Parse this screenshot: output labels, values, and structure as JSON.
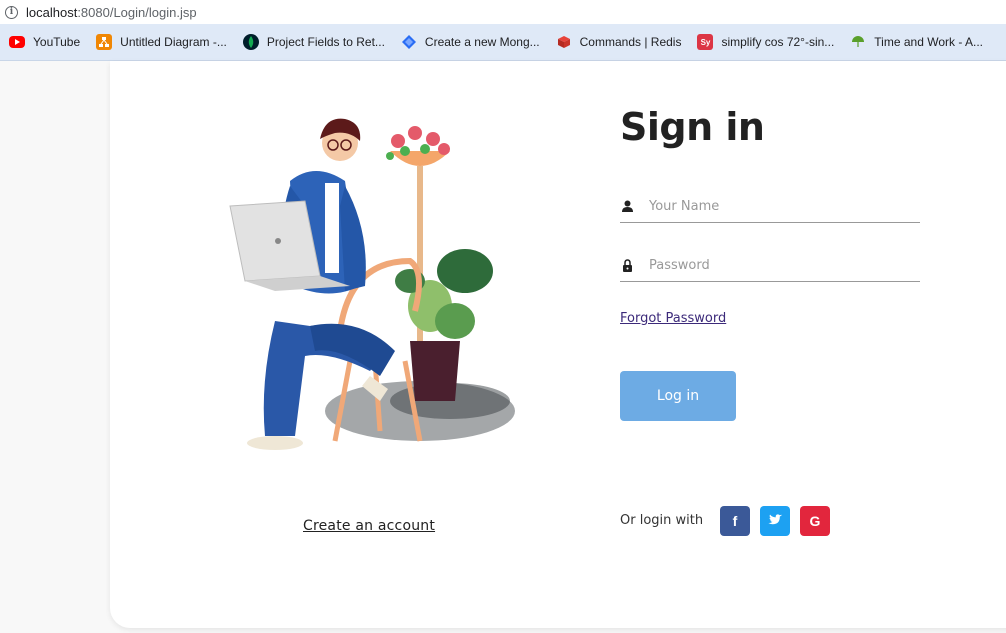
{
  "browser": {
    "url_host": "localhost",
    "url_path": ":8080/Login/login.jsp",
    "bookmarks": [
      {
        "label": "YouTube",
        "icon": "youtube-icon",
        "color": "#ff0000"
      },
      {
        "label": "Untitled Diagram -...",
        "icon": "drawio-icon",
        "color": "#f08705"
      },
      {
        "label": "Project Fields to Ret...",
        "icon": "mongodb-icon",
        "color": "#13aa52"
      },
      {
        "label": "Create a new Mong...",
        "icon": "diamond-icon",
        "color": "#2a6df4"
      },
      {
        "label": "Commands | Redis",
        "icon": "redis-icon",
        "color": "#d82c20"
      },
      {
        "label": "simplify cos 72°-sin...",
        "icon": "symbolab-icon",
        "color": "#dc3545",
        "badge": "Sy"
      },
      {
        "label": "Time and Work - A...",
        "icon": "umbrella-icon",
        "color": "#5aa02c"
      }
    ]
  },
  "login": {
    "title": "Sign in",
    "name_placeholder": "Your Name",
    "password_placeholder": "Password",
    "forgot_label": "Forgot Password",
    "login_button": "Log in",
    "or_login_with": "Or login with",
    "create_account": "Create an account",
    "social": [
      {
        "name": "facebook",
        "glyph": "f",
        "color": "#3b5998"
      },
      {
        "name": "twitter",
        "glyph": "t",
        "color": "#1da1f2"
      },
      {
        "name": "google",
        "glyph": "G",
        "color": "#e2263d"
      }
    ],
    "colors": {
      "button": "#6dabe4",
      "title": "#222222",
      "link": "#3c2a7a"
    }
  }
}
